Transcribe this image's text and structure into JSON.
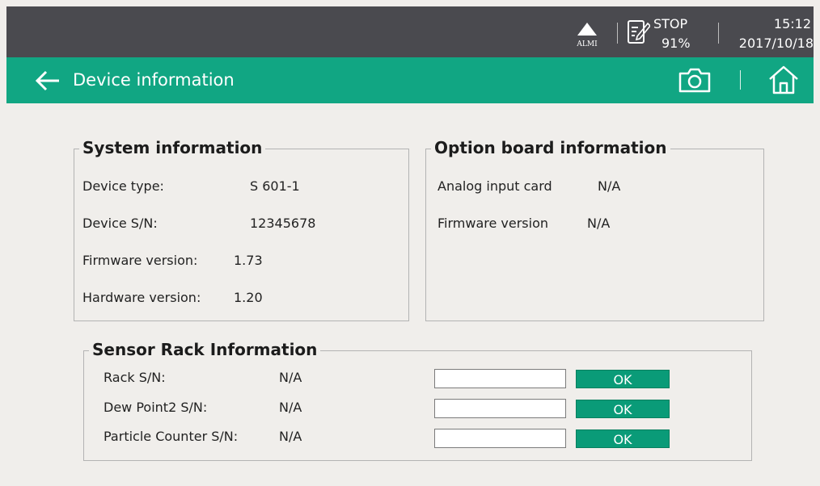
{
  "status": {
    "alarm_label": "ALMI",
    "run_state": "STOP",
    "level": "91%",
    "time": "15:12",
    "date": "2017/10/18"
  },
  "header": {
    "title": "Device information",
    "back_icon": "arrow-left-icon",
    "camera_icon": "camera-icon",
    "home_icon": "home-icon"
  },
  "system_info": {
    "title": "System information",
    "rows": [
      {
        "label": "Device type:",
        "value": "S 601-1"
      },
      {
        "label": "Device S/N:",
        "value": "12345678"
      },
      {
        "label": "Firmware version:",
        "value": "1.73"
      },
      {
        "label": "Hardware version:",
        "value": "1.20"
      }
    ]
  },
  "option_board": {
    "title": "Option board information",
    "rows": [
      {
        "label": "Analog input card",
        "value": "N/A"
      },
      {
        "label": "Firmware version",
        "value": "N/A"
      }
    ]
  },
  "sensor_rack": {
    "title": "Sensor Rack Information",
    "rows": [
      {
        "label": "Rack S/N:",
        "value": "N/A",
        "input": "",
        "button": "OK"
      },
      {
        "label": "Dew Point2 S/N:",
        "value": "N/A",
        "input": "",
        "button": "OK"
      },
      {
        "label": "Particle Counter S/N:",
        "value": "N/A",
        "input": "",
        "button": "OK"
      }
    ]
  },
  "colors": {
    "status_bar": "#4a4a4f",
    "title_bar": "#11a683",
    "ok_button": "#0a9b78",
    "background": "#f0eeeb"
  }
}
